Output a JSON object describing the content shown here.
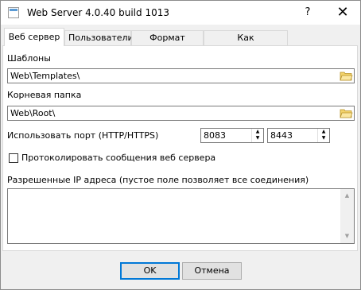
{
  "window": {
    "title": "Web Server 4.0.40 build 1013",
    "help_label": "?",
    "close_label": "✕"
  },
  "tabs": [
    {
      "label": "Веб сервер"
    },
    {
      "label": "Пользователи"
    },
    {
      "label": "Формат данных"
    },
    {
      "label": "Как подключиться"
    }
  ],
  "templates": {
    "label": "Шаблоны",
    "value": "Web\\Templates\\"
  },
  "root": {
    "label": "Корневая папка",
    "value": "Web\\Root\\"
  },
  "port": {
    "label": "Использовать порт (HTTP/HTTPS)",
    "http": "8083",
    "https": "8443"
  },
  "log_checkbox": {
    "label": "Протоколировать сообщения веб сервера",
    "checked": false
  },
  "allowed_ip": {
    "label": "Разрешенные IP адреса (пустое поле позволяет все соединения)",
    "value": ""
  },
  "buttons": {
    "ok": "OK",
    "cancel": "Отмена"
  },
  "icons": {
    "folder": "folder-open-icon",
    "spin_up": "spin-up-icon",
    "spin_down": "spin-down-icon"
  }
}
